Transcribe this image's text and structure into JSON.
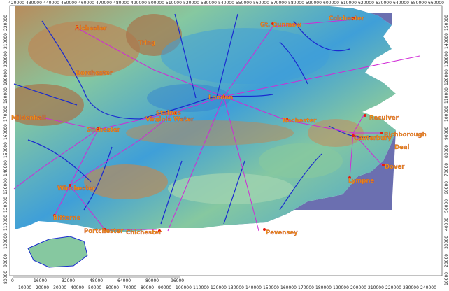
{
  "top_ticks": [
    "420000",
    "430000",
    "440000",
    "450000",
    "460000",
    "470000",
    "480000",
    "490000",
    "500000",
    "510000",
    "520000",
    "530000",
    "540000",
    "550000",
    "560000",
    "570000",
    "580000",
    "590000",
    "600000",
    "610000",
    "620000",
    "630000",
    "640000",
    "650000",
    "660000"
  ],
  "right_ticks": [
    "150000",
    "140000",
    "130000",
    "120000",
    "110000",
    "100000",
    "90000",
    "80000",
    "70000",
    "60000",
    "50000",
    "40000",
    "30000",
    "20000",
    "10000"
  ],
  "left_ticks": [
    "220000",
    "210000",
    "200000",
    "190000",
    "180000",
    "170000",
    "160000",
    "150000",
    "140000",
    "130000",
    "120000",
    "110000",
    "100000",
    "90000",
    "80000"
  ],
  "bottom_ticks": [
    "10000",
    "20000",
    "30000",
    "40000",
    "50000",
    "60000",
    "70000",
    "80000",
    "90000",
    "100000",
    "110000",
    "120000",
    "130000",
    "140000",
    "150000",
    "160000",
    "170000",
    "180000",
    "190000",
    "200000",
    "210000",
    "220000",
    "230000",
    "240000"
  ],
  "scale_ticks": [
    "0",
    "16000",
    "32000",
    "48000",
    "64000",
    "80000",
    "96000"
  ],
  "places": {
    "alchester": "Alchester",
    "dunmow": "Gt. Dunmow",
    "colchester": "Colchester",
    "tring": "Tring",
    "dorchester": "Dorchester",
    "london": "London",
    "mildenhall": "Mildenhall",
    "staines": "Staines",
    "virginia_water": "Virginia Water",
    "silchester": "Silchester",
    "rochester": "Rochester",
    "reculver": "Reculver",
    "canterbury": "Canterbury",
    "richborough": "Richborough",
    "deal": "Deal",
    "dover": "Dover",
    "lympne": "Lympne",
    "winchester": "Winchester",
    "bitterne": "Bitterne",
    "portchester": "Portchester",
    "chichester": "Chichester",
    "pevensey": "Pevensey"
  },
  "colors": {
    "sea": "#6b6fb0",
    "lowland": "#3f9fd8",
    "midland": "#86c8a0",
    "upland": "#b98a5a",
    "rivers": "#1a2bd0",
    "roads": "#d02ad6",
    "label": "#e8901a",
    "town_dot": "#e8190c"
  }
}
